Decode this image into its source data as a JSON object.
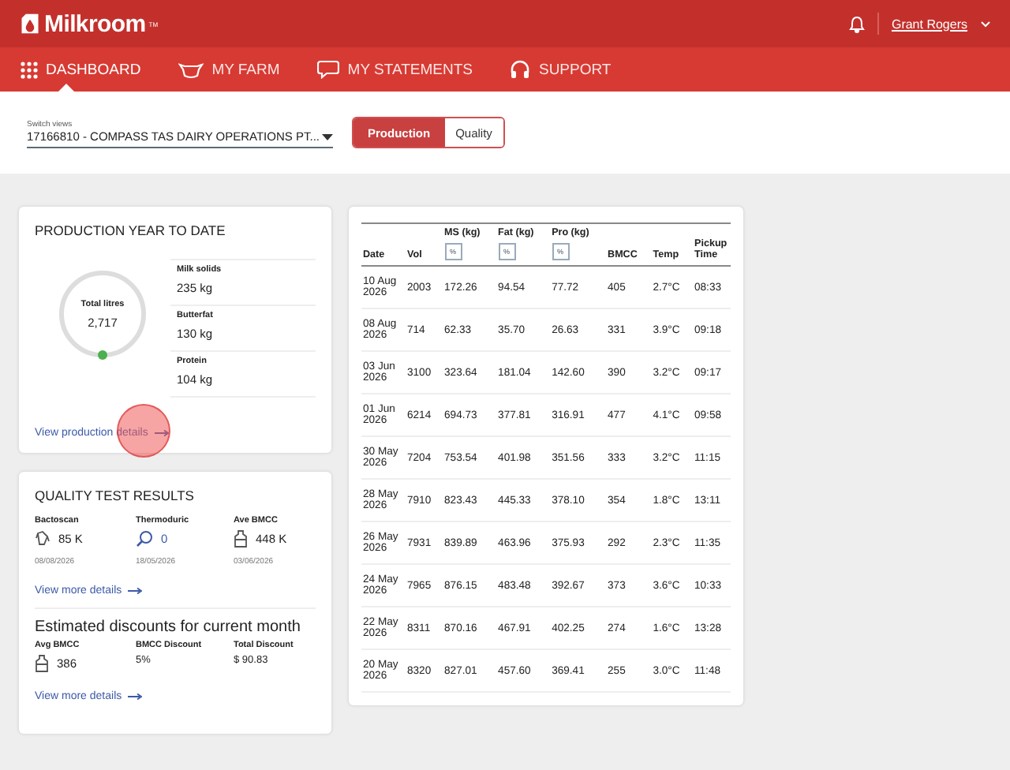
{
  "header": {
    "brand": "Milkroom",
    "trademark": "TM",
    "user": "Grant Rogers"
  },
  "nav": [
    {
      "label": "DASHBOARD",
      "selected": true
    },
    {
      "label": "MY FARM",
      "selected": false
    },
    {
      "label": "MY STATEMENTS",
      "selected": false
    },
    {
      "label": "SUPPORT",
      "selected": false
    }
  ],
  "switcher": {
    "label": "Switch views",
    "value": "17166810 - COMPASS TAS DAIRY OPERATIONS PT..."
  },
  "view_toggle": [
    {
      "label": "Production",
      "selected": true
    },
    {
      "label": "Quality",
      "selected": false
    }
  ],
  "production": {
    "title": "PRODUCTION YEAR TO DATE",
    "gauge_label": "Total litres",
    "gauge_value": "2,717",
    "stats": [
      {
        "label": "Milk solids",
        "value": "235 kg"
      },
      {
        "label": "Butterfat",
        "value": "130 kg"
      },
      {
        "label": "Protein",
        "value": "104 kg"
      }
    ],
    "link": "View production details"
  },
  "quality": {
    "title": "QUALITY TEST RESULTS",
    "tests": [
      {
        "label": "Bactoscan",
        "value": "85 K",
        "date": "08/08/2026",
        "highlighted": false
      },
      {
        "label": "Thermoduric",
        "value": "0",
        "date": "18/05/2026",
        "highlighted": true
      },
      {
        "label": "Ave BMCC",
        "value": "448 K",
        "date": "03/06/2026",
        "highlighted": false
      }
    ],
    "link": "View more details",
    "discount_title": "Estimated discounts for current month",
    "discounts": [
      {
        "label": "Avg BMCC",
        "value": "386"
      },
      {
        "label": "BMCC Discount",
        "value": "5%"
      },
      {
        "label": "Total Discount",
        "value": "$ 90.83"
      }
    ],
    "discount_link": "View more details"
  },
  "table": {
    "columns": [
      {
        "label": "Date",
        "kind": "plain"
      },
      {
        "label": "Vol",
        "kind": "plain"
      },
      {
        "label": "MS (kg)",
        "kind": "toggle",
        "toggle": "%"
      },
      {
        "label": "Fat (kg)",
        "kind": "toggle",
        "toggle": "%"
      },
      {
        "label": "Pro (kg)",
        "kind": "toggle",
        "toggle": "%"
      },
      {
        "label": "BMCC",
        "kind": "plain"
      },
      {
        "label": "Temp",
        "kind": "plain"
      },
      {
        "label": "Pickup Time",
        "kind": "plain"
      }
    ],
    "rows": [
      [
        "10 Aug 2026",
        "2003",
        "172.26",
        "94.54",
        "77.72",
        "405",
        "2.7°C",
        "08:33"
      ],
      [
        "08 Aug 2026",
        "714",
        "62.33",
        "35.70",
        "26.63",
        "331",
        "3.9°C",
        "09:18"
      ],
      [
        "03 Jun 2026",
        "3100",
        "323.64",
        "181.04",
        "142.60",
        "390",
        "3.2°C",
        "09:17"
      ],
      [
        "01 Jun 2026",
        "6214",
        "694.73",
        "377.81",
        "316.91",
        "477",
        "4.1°C",
        "09:58"
      ],
      [
        "30 May 2026",
        "7204",
        "753.54",
        "401.98",
        "351.56",
        "333",
        "3.2°C",
        "11:15"
      ],
      [
        "28 May 2026",
        "7910",
        "823.43",
        "445.33",
        "378.10",
        "354",
        "1.8°C",
        "13:11"
      ],
      [
        "26 May 2026",
        "7931",
        "839.89",
        "463.96",
        "375.93",
        "292",
        "2.3°C",
        "11:35"
      ],
      [
        "24 May 2026",
        "7965",
        "876.15",
        "483.48",
        "392.67",
        "373",
        "3.6°C",
        "10:33"
      ],
      [
        "22 May 2026",
        "8311",
        "870.16",
        "467.91",
        "402.25",
        "274",
        "1.6°C",
        "13:28"
      ],
      [
        "20 May 2026",
        "8320",
        "827.01",
        "457.60",
        "369.41",
        "255",
        "3.0°C",
        "11:48"
      ]
    ]
  }
}
